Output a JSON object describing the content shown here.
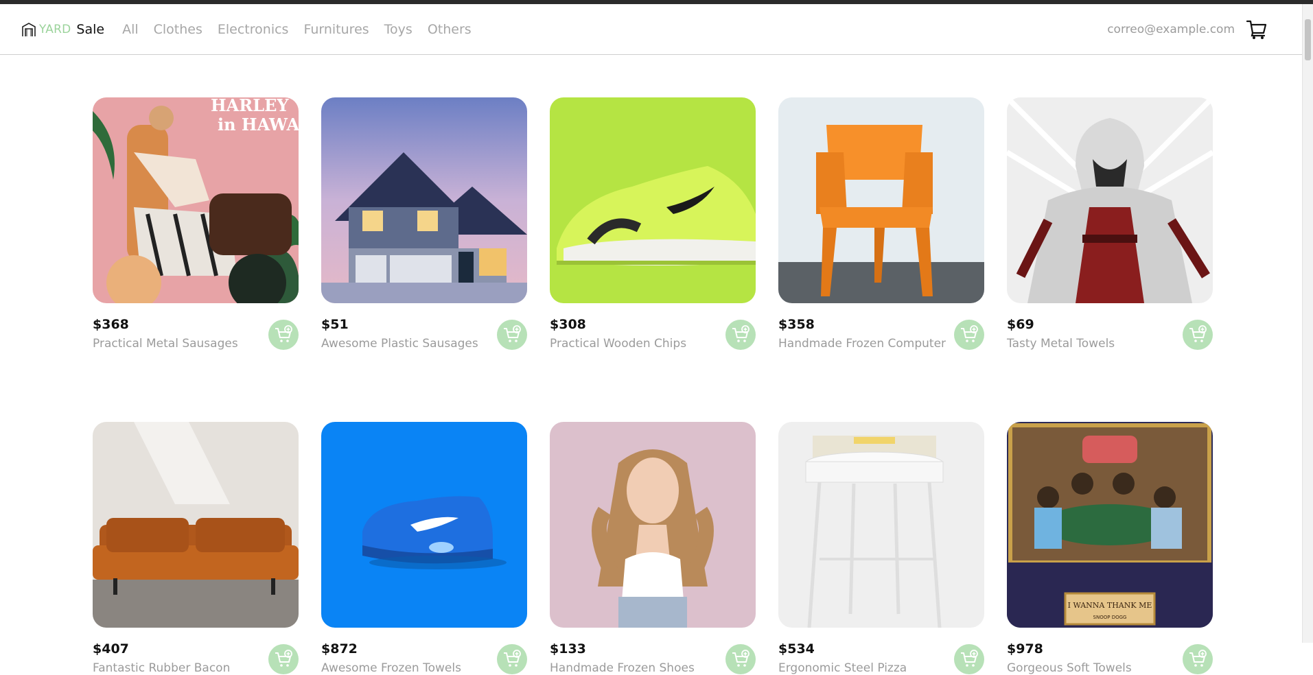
{
  "brand": {
    "yard": "YARD",
    "sale": "Sale",
    "logo_icon": "barn-icon"
  },
  "categories": [
    "All",
    "Clothes",
    "Electronics",
    "Furnitures",
    "Toys",
    "Others"
  ],
  "user": {
    "email": "correo@example.com"
  },
  "header_cart_icon": "shopping-cart-icon",
  "products": [
    {
      "price": "$368",
      "name": "Practical Metal Sausages",
      "image": "motorcycle-fashion-poster"
    },
    {
      "price": "$51",
      "name": "Awesome Plastic Sausages",
      "image": "house-exterior"
    },
    {
      "price": "$308",
      "name": "Practical Wooden Chips",
      "image": "green-sneaker"
    },
    {
      "price": "$358",
      "name": "Handmade Frozen Computer",
      "image": "orange-chair"
    },
    {
      "price": "$69",
      "name": "Tasty Metal Towels",
      "image": "hooded-assassin"
    },
    {
      "price": "$407",
      "name": "Fantastic Rubber Bacon",
      "image": "leather-sofa"
    },
    {
      "price": "$872",
      "name": "Awesome Frozen Towels",
      "image": "blue-sneaker"
    },
    {
      "price": "$133",
      "name": "Handmade Frozen Shoes",
      "image": "woman-portrait"
    },
    {
      "price": "$534",
      "name": "Ergonomic Steel Pizza",
      "image": "white-stool-with-book"
    },
    {
      "price": "$978",
      "name": "Gorgeous Soft Towels",
      "image": "poker-painting"
    }
  ],
  "image_text": {
    "poster_line1": "HARLEY",
    "poster_line2": "in HAWA",
    "painting_plaque": "I WANNA THANK ME",
    "painting_sub": "SNOOP DOGG"
  },
  "colors": {
    "accent_green": "#9bd39b",
    "add_button_bg": "#b7e1b7",
    "muted_text": "#a7a7a7"
  }
}
